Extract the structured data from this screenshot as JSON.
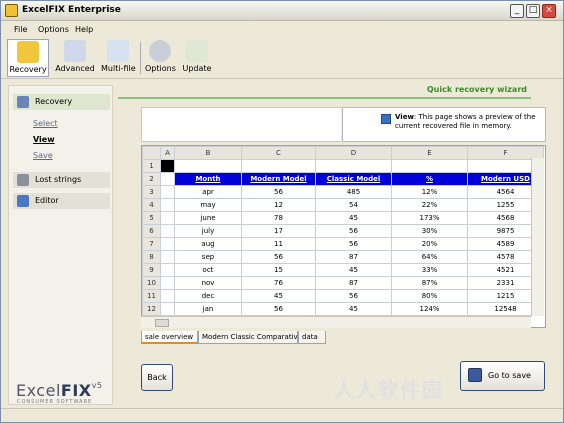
{
  "window": {
    "title": "ExcelFIX  Enterprise"
  },
  "menu": [
    "File",
    "Options",
    "Help"
  ],
  "toolbar": [
    {
      "label": "Recovery",
      "icon": "recovery-icon",
      "active": true
    },
    {
      "label": "Advanced",
      "icon": "advanced-icon"
    },
    {
      "label": "Multi-file",
      "icon": "multi-file-icon"
    },
    {
      "label": "Options",
      "icon": "options-icon"
    },
    {
      "label": "Update",
      "icon": "update-icon"
    }
  ],
  "wizard_title": "Quick recovery wizard",
  "sidebar": {
    "recovery": "Recovery",
    "select": "Select",
    "view": "View",
    "save": "Save",
    "lost_strings": "Lost strings",
    "editor": "Editor"
  },
  "logo": {
    "excel": "Excel",
    "fix": "FIX",
    "version": "v5",
    "subtitle": "CONSUMER  SOFTWARE"
  },
  "info": {
    "bold": "View",
    "text": ": This page shows a preview of the current recovered file in memory."
  },
  "grid": {
    "columns": [
      "A",
      "B",
      "C",
      "D",
      "E",
      "F"
    ],
    "headers": [
      "Month",
      "Modern Model",
      "Classic Model",
      "%",
      "Modern USD"
    ],
    "rows": [
      [
        "apr",
        "56",
        "485",
        "12%",
        "4564"
      ],
      [
        "may",
        "12",
        "54",
        "22%",
        "1255"
      ],
      [
        "june",
        "78",
        "45",
        "173%",
        "4568"
      ],
      [
        "july",
        "17",
        "56",
        "30%",
        "9875"
      ],
      [
        "aug",
        "11",
        "56",
        "20%",
        "4589"
      ],
      [
        "sep",
        "56",
        "87",
        "64%",
        "4578"
      ],
      [
        "oct",
        "15",
        "45",
        "33%",
        "4521"
      ],
      [
        "nov",
        "76",
        "87",
        "87%",
        "2331"
      ],
      [
        "dec",
        "45",
        "56",
        "80%",
        "1215"
      ],
      [
        "jan",
        "56",
        "45",
        "124%",
        "12548"
      ]
    ]
  },
  "sheet_tabs": [
    "sale overview",
    "Modern Classic Comparative",
    "data"
  ],
  "buttons": {
    "back": "Back",
    "go_to_save": "Go to save"
  },
  "watermark": "人人软件园",
  "colors": {
    "header_blue": "#0000d8",
    "wizard_green": "#3a8a2a"
  }
}
